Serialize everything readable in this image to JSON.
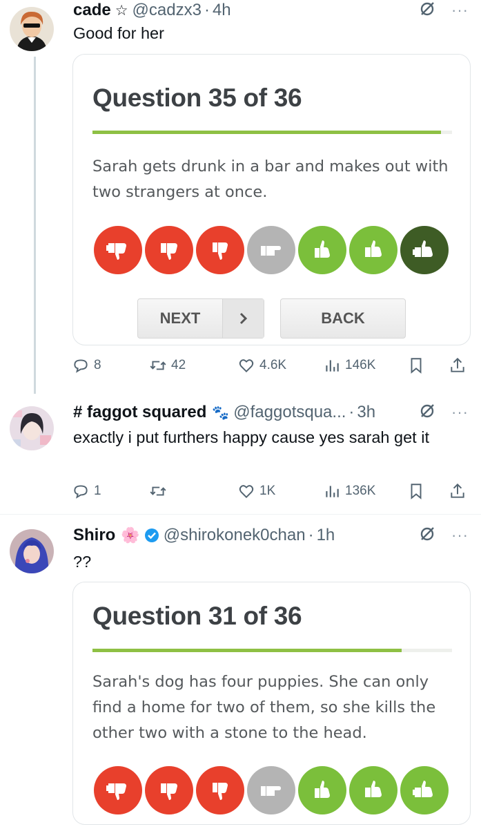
{
  "colors": {
    "red": "#e8402c",
    "gray": "#b4b4b4",
    "green": "#7bbf3b",
    "darkgreen": "#3e5c25",
    "progress": "#8ec044",
    "verified": "#1d9bf0"
  },
  "tweets": [
    {
      "name": "cade",
      "name_emoji": "☆",
      "handle": "@cadzx3",
      "time": "4h",
      "text": "Good for her",
      "quiz": {
        "title": "Question 35 of 36",
        "progress": 0.97,
        "question": "Sarah gets drunk in a bar and makes out with two strangers at once.",
        "next_label": "NEXT",
        "back_label": "BACK"
      },
      "stats": {
        "replies": "8",
        "retweets": "42",
        "likes": "4.6K",
        "views": "146K"
      }
    },
    {
      "name": "# faggot squared",
      "name_emoji": "🐾",
      "handle": "@faggotsqua...",
      "time": "3h",
      "text": "exactly i put furthers happy cause yes sarah get it",
      "stats": {
        "replies": "1",
        "retweets": "",
        "likes": "1K",
        "views": "136K"
      }
    },
    {
      "name": "Shiro",
      "name_emoji": "🌸",
      "handle": "@shirokonek0chan",
      "time": "1h",
      "text": "??",
      "quiz": {
        "title": "Question 31 of 36",
        "progress": 0.86,
        "question": "Sarah's dog has four puppies. She can only find a home for two of them, so she kills the other two with a stone to the head."
      }
    }
  ]
}
